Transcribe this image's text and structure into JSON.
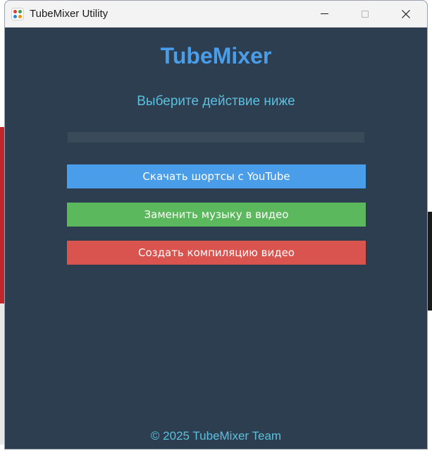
{
  "window": {
    "title": "TubeMixer Utility",
    "controls": {
      "minimize": "minimize",
      "maximize": "maximize",
      "close": "close"
    }
  },
  "app": {
    "title": "TubeMixer",
    "subtitle": "Выберите действие ниже",
    "progress": 0,
    "buttons": {
      "download": "Скачать шортсы с YouTube",
      "replace_music": "Заменить музыку в видео",
      "compile": "Создать компиляцию видео"
    },
    "footer": "© 2025 TubeMixer Team"
  },
  "colors": {
    "background": "#2c3e50",
    "accent_blue": "#4a9de8",
    "green": "#5cb85c",
    "red": "#d9534f",
    "text_cyan": "#5bc0de"
  },
  "icons": {
    "app": "app-logo-icon",
    "minimize": "minimize-icon",
    "maximize": "maximize-icon",
    "close": "close-icon"
  }
}
